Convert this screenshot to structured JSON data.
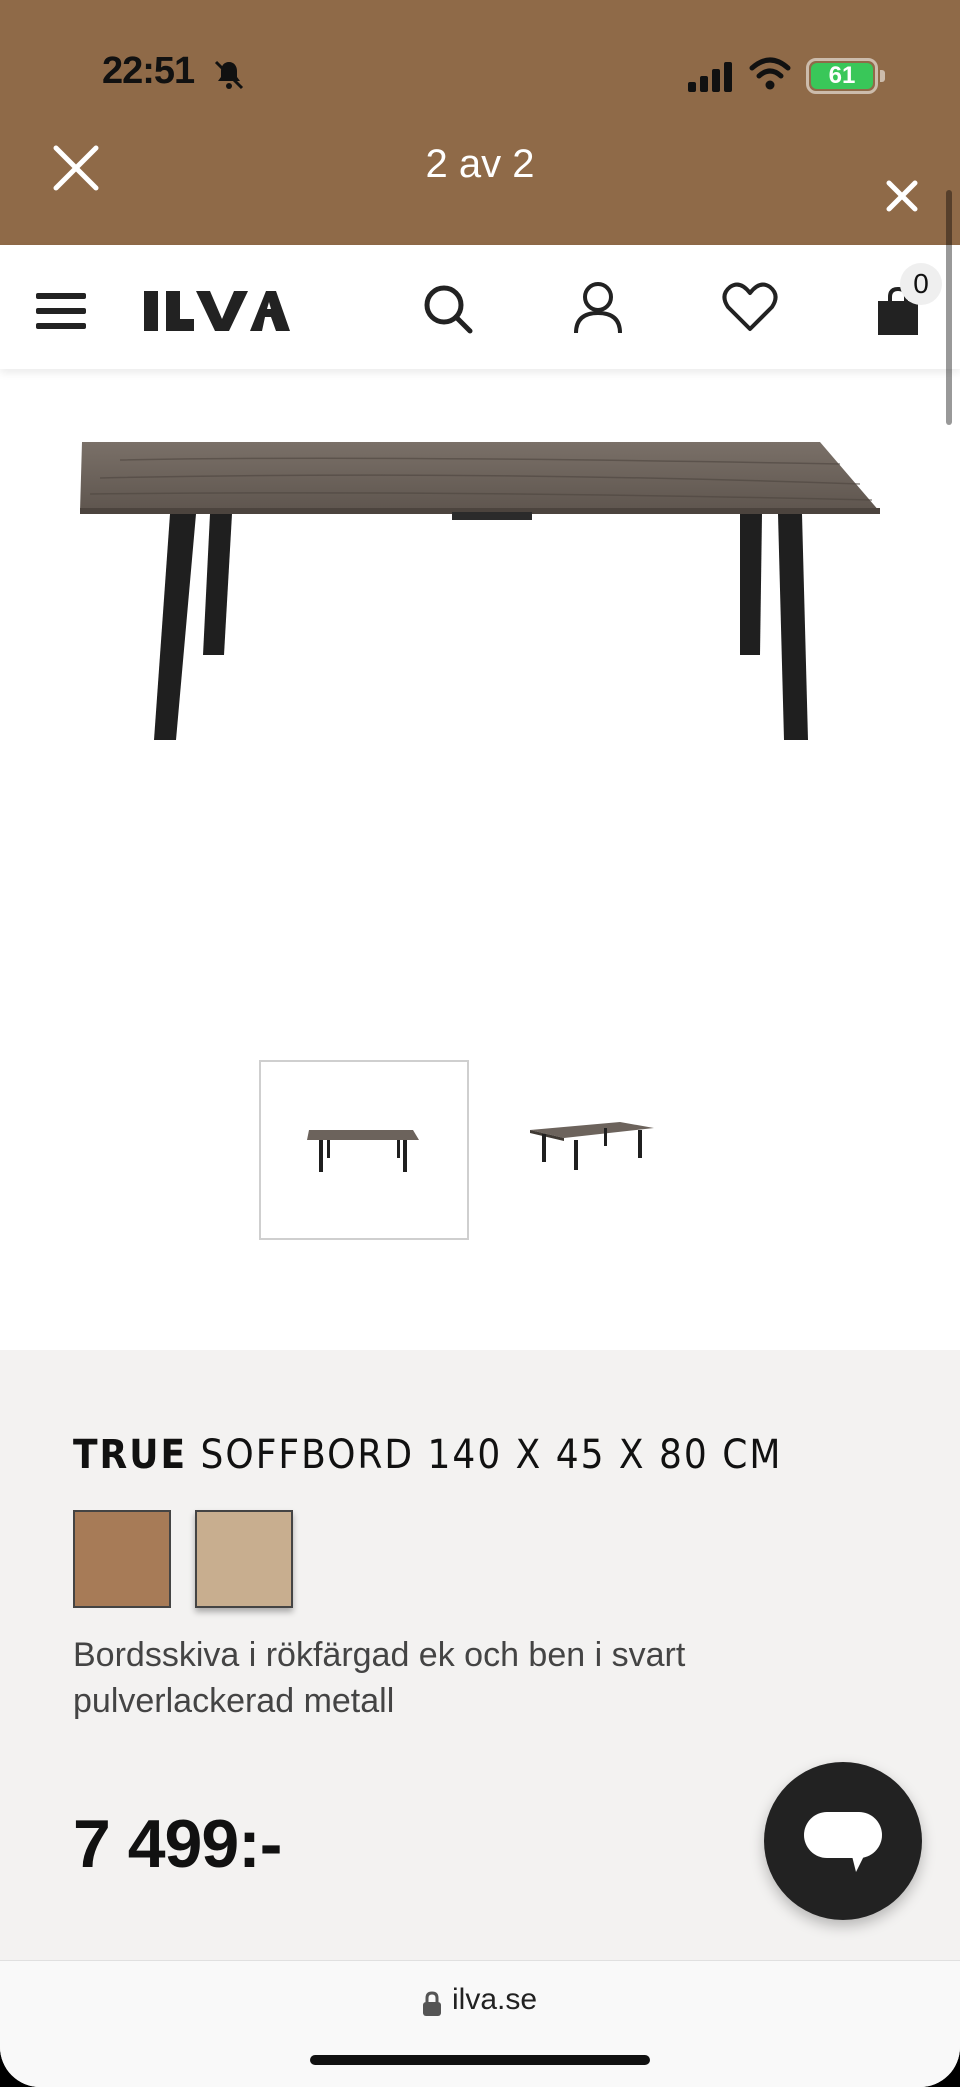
{
  "status_bar": {
    "time": "22:51",
    "battery": "61"
  },
  "overlay": {
    "counter": "2 av 2"
  },
  "header": {
    "logo_text": "ILVA",
    "cart_count": "0"
  },
  "gallery": {
    "thumbnails": [
      "thumb-front",
      "thumb-angle"
    ],
    "active_index": 0
  },
  "product": {
    "brand": "TRUE",
    "name": "SOFFBORD 140 X 45 X 80 CM",
    "swatches": [
      "#a77b57",
      "#c8ae8f"
    ],
    "description": "Bordsskiva i rökfärgad ek och ben i svart pulverlackerad metall",
    "price": "7 499:-"
  },
  "browser": {
    "url": "ilva.se"
  },
  "colors": {
    "overlay_bg": "#8f6a48",
    "info_bg": "#f3f2f1",
    "chat_bg": "#222222"
  }
}
